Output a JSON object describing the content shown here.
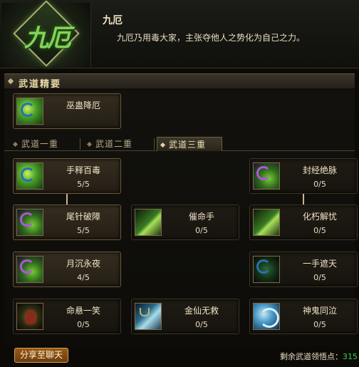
{
  "header": {
    "emblem_text": "九厄",
    "title": "九厄",
    "description": "九厄乃用毒大家，主张夺他人之势化为自己之力。"
  },
  "section": {
    "title": "武道精要"
  },
  "essence_skill": {
    "name": "巫蛊降厄",
    "icon": "toxin-orb-icon"
  },
  "tabs": [
    {
      "label": "武道一重",
      "active": false
    },
    {
      "label": "武道二重",
      "active": false
    },
    {
      "label": "武道三重",
      "active": true
    }
  ],
  "skills": {
    "r1c1": {
      "name": "手释百毒",
      "level": "5/5",
      "icon": "toxin-orb-icon"
    },
    "r1c3": {
      "name": "封经绝脉",
      "level": "0/5",
      "icon": "violet-vine-icon"
    },
    "r2c1": {
      "name": "尾针破障",
      "level": "5/5",
      "icon": "violet-sting-icon"
    },
    "r2c2": {
      "name": "催命手",
      "level": "0/5",
      "icon": "green-slash-icon"
    },
    "r2c3": {
      "name": "化朽解忧",
      "level": "0/5",
      "icon": "green-wave-icon"
    },
    "r3c1": {
      "name": "月沉永夜",
      "level": "4/5",
      "icon": "violet-moon-icon"
    },
    "r3c3": {
      "name": "一手遮天",
      "level": "0/5",
      "icon": "shadow-hand-icon"
    },
    "r4c1": {
      "name": "命悬一笑",
      "level": "0/5",
      "icon": "red-demon-icon"
    },
    "r4c2": {
      "name": "金仙无救",
      "level": "0/5",
      "icon": "blue-blade-icon"
    },
    "r4c3": {
      "name": "神鬼同泣",
      "level": "0/5",
      "icon": "azure-spirit-icon"
    }
  },
  "footer": {
    "share_label": "分享至聊天",
    "points_label": "剩余武道领悟点：",
    "points_value": "315"
  },
  "colors": {
    "accent_gold": "#c9b68a",
    "points_green": "#3ed04a",
    "share_button": "#8a4e16"
  }
}
